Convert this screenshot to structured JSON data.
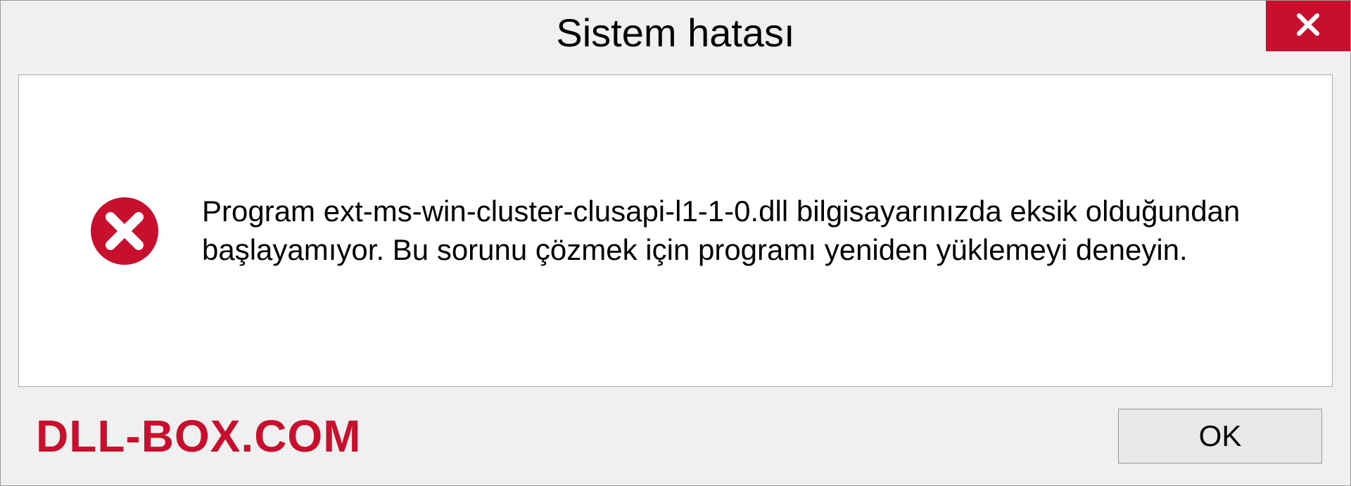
{
  "dialog": {
    "title": "Sistem hatası",
    "message": "Program ext-ms-win-cluster-clusapi-l1-1-0.dll bilgisayarınızda eksik olduğundan başlayamıyor. Bu sorunu çözmek için programı yeniden yüklemeyi deneyin.",
    "ok_label": "OK"
  },
  "watermark": "DLL-BOX.COM",
  "colors": {
    "accent_red": "#c8102e",
    "background": "#f0f0f0"
  }
}
